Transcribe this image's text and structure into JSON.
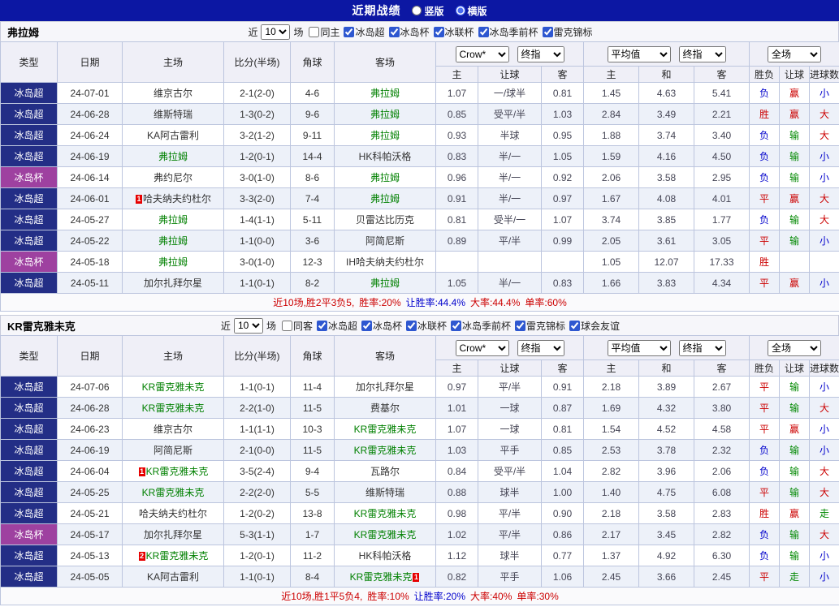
{
  "colors": {
    "bar-bg": "#0c17a3",
    "league-bg": "#232e86",
    "cup-bg": "#9e41a0",
    "header-bg": "#efeff7",
    "filter-bg": "#f6f6fa",
    "alt-row": "#edf1f9",
    "summary-bg": "#fafafc",
    "border": "#bcc5de",
    "focus-green": "#008000",
    "red": "#cc0000",
    "blue": "#0000cc",
    "green": "#008800",
    "badge-red": "#e60000"
  },
  "topbar": {
    "title": "近期战绩",
    "options": [
      {
        "label": "竖版",
        "checked": false
      },
      {
        "label": "横版",
        "checked": true
      }
    ]
  },
  "headers": {
    "main": [
      "类型",
      "日期",
      "主场",
      "比分(半场)",
      "角球",
      "客场"
    ],
    "sub": [
      "主",
      "让球",
      "客",
      "主",
      "和",
      "客",
      "胜负",
      "让球",
      "进球数"
    ],
    "selects": {
      "company": "Crow*",
      "asian_time": "终指",
      "euro_type": "平均值",
      "euro_time": "终指",
      "scope": "全场"
    }
  },
  "teams": [
    {
      "name": "弗拉姆",
      "filter": {
        "near": "近",
        "count": "10",
        "games": "场",
        "same": {
          "label": "同主",
          "checked": false
        },
        "comps": [
          {
            "label": "冰岛超",
            "checked": true
          },
          {
            "label": "冰岛杯",
            "checked": true
          },
          {
            "label": "冰联杯",
            "checked": true
          },
          {
            "label": "冰岛季前杯",
            "checked": true
          },
          {
            "label": "雷克锦标",
            "checked": true
          }
        ]
      },
      "rows": [
        {
          "comp": "冰岛超",
          "cup": false,
          "date": "24-07-01",
          "home": {
            "name": "维京古尔",
            "focus": false
          },
          "score": "2-1(2-0)",
          "corner": "4-6",
          "away": {
            "name": "弗拉姆",
            "focus": true
          },
          "asian": [
            "1.07",
            "一/球半",
            "0.81"
          ],
          "euro": [
            "1.45",
            "4.63",
            "5.41"
          ],
          "res": [
            {
              "t": "负",
              "c": "blue"
            },
            {
              "t": "赢",
              "c": "red"
            },
            {
              "t": "小",
              "c": "blue"
            }
          ]
        },
        {
          "comp": "冰岛超",
          "cup": false,
          "date": "24-06-28",
          "home": {
            "name": "维斯特瑞",
            "focus": false
          },
          "score": "1-3(0-2)",
          "corner": "9-6",
          "away": {
            "name": "弗拉姆",
            "focus": true
          },
          "asian": [
            "0.85",
            "受平/半",
            "1.03"
          ],
          "euro": [
            "2.84",
            "3.49",
            "2.21"
          ],
          "res": [
            {
              "t": "胜",
              "c": "red"
            },
            {
              "t": "赢",
              "c": "red"
            },
            {
              "t": "大",
              "c": "red"
            }
          ]
        },
        {
          "comp": "冰岛超",
          "cup": false,
          "date": "24-06-24",
          "home": {
            "name": "KA阿古雷利",
            "focus": false
          },
          "score": "3-2(1-2)",
          "corner": "9-11",
          "away": {
            "name": "弗拉姆",
            "focus": true
          },
          "asian": [
            "0.93",
            "半球",
            "0.95"
          ],
          "euro": [
            "1.88",
            "3.74",
            "3.40"
          ],
          "res": [
            {
              "t": "负",
              "c": "blue"
            },
            {
              "t": "输",
              "c": "green"
            },
            {
              "t": "大",
              "c": "red"
            }
          ]
        },
        {
          "comp": "冰岛超",
          "cup": false,
          "date": "24-06-19",
          "home": {
            "name": "弗拉姆",
            "focus": true
          },
          "score": "1-2(0-1)",
          "corner": "14-4",
          "away": {
            "name": "HK科帕沃格",
            "focus": false
          },
          "asian": [
            "0.83",
            "半/一",
            "1.05"
          ],
          "euro": [
            "1.59",
            "4.16",
            "4.50"
          ],
          "res": [
            {
              "t": "负",
              "c": "blue"
            },
            {
              "t": "输",
              "c": "green"
            },
            {
              "t": "小",
              "c": "blue"
            }
          ]
        },
        {
          "comp": "冰岛杯",
          "cup": true,
          "date": "24-06-14",
          "home": {
            "name": "弗约尼尔",
            "focus": false
          },
          "score": "3-0(1-0)",
          "corner": "8-6",
          "away": {
            "name": "弗拉姆",
            "focus": true
          },
          "asian": [
            "0.96",
            "半/一",
            "0.92"
          ],
          "euro": [
            "2.06",
            "3.58",
            "2.95"
          ],
          "res": [
            {
              "t": "负",
              "c": "blue"
            },
            {
              "t": "输",
              "c": "green"
            },
            {
              "t": "小",
              "c": "blue"
            }
          ]
        },
        {
          "comp": "冰岛超",
          "cup": false,
          "date": "24-06-01",
          "home": {
            "name": "哈夫纳夫约杜尔",
            "focus": false,
            "badge": "1",
            "badge_pos": "before"
          },
          "score": "3-3(2-0)",
          "corner": "7-4",
          "away": {
            "name": "弗拉姆",
            "focus": true
          },
          "asian": [
            "0.91",
            "半/一",
            "0.97"
          ],
          "euro": [
            "1.67",
            "4.08",
            "4.01"
          ],
          "res": [
            {
              "t": "平",
              "c": "red"
            },
            {
              "t": "赢",
              "c": "red"
            },
            {
              "t": "大",
              "c": "red"
            }
          ]
        },
        {
          "comp": "冰岛超",
          "cup": false,
          "date": "24-05-27",
          "home": {
            "name": "弗拉姆",
            "focus": true
          },
          "score": "1-4(1-1)",
          "corner": "5-11",
          "away": {
            "name": "贝雷达比历克",
            "focus": false
          },
          "asian": [
            "0.81",
            "受半/一",
            "1.07"
          ],
          "euro": [
            "3.74",
            "3.85",
            "1.77"
          ],
          "res": [
            {
              "t": "负",
              "c": "blue"
            },
            {
              "t": "输",
              "c": "green"
            },
            {
              "t": "大",
              "c": "red"
            }
          ]
        },
        {
          "comp": "冰岛超",
          "cup": false,
          "date": "24-05-22",
          "home": {
            "name": "弗拉姆",
            "focus": true
          },
          "score": "1-1(0-0)",
          "corner": "3-6",
          "away": {
            "name": "阿简尼斯",
            "focus": false
          },
          "asian": [
            "0.89",
            "平/半",
            "0.99"
          ],
          "euro": [
            "2.05",
            "3.61",
            "3.05"
          ],
          "res": [
            {
              "t": "平",
              "c": "red"
            },
            {
              "t": "输",
              "c": "green"
            },
            {
              "t": "小",
              "c": "blue"
            }
          ]
        },
        {
          "comp": "冰岛杯",
          "cup": true,
          "date": "24-05-18",
          "home": {
            "name": "弗拉姆",
            "focus": true
          },
          "score": "3-0(1-0)",
          "corner": "12-3",
          "away": {
            "name": "IH哈夫纳夫约杜尔",
            "focus": false
          },
          "asian": [
            "",
            "",
            ""
          ],
          "euro": [
            "1.05",
            "12.07",
            "17.33"
          ],
          "res": [
            {
              "t": "胜",
              "c": "red"
            },
            {
              "t": "",
              "c": ""
            },
            {
              "t": "",
              "c": ""
            }
          ]
        },
        {
          "comp": "冰岛超",
          "cup": false,
          "date": "24-05-11",
          "home": {
            "name": "加尔扎拜尔星",
            "focus": false
          },
          "score": "1-1(0-1)",
          "corner": "8-2",
          "away": {
            "name": "弗拉姆",
            "focus": true
          },
          "asian": [
            "1.05",
            "半/一",
            "0.83"
          ],
          "euro": [
            "1.66",
            "3.83",
            "4.34"
          ],
          "res": [
            {
              "t": "平",
              "c": "red"
            },
            {
              "t": "赢",
              "c": "red"
            },
            {
              "t": "小",
              "c": "blue"
            }
          ]
        }
      ],
      "summary": [
        {
          "t": "近10场,胜2平3负5,",
          "c": "red"
        },
        {
          "t": "胜率:20%",
          "c": "red"
        },
        {
          "t": "让胜率:44.4%",
          "c": "blue"
        },
        {
          "t": "大率:44.4%",
          "c": "red"
        },
        {
          "t": "单率:60%",
          "c": "red"
        }
      ]
    },
    {
      "name": "KR雷克雅未克",
      "filter": {
        "near": "近",
        "count": "10",
        "games": "场",
        "same": {
          "label": "同客",
          "checked": false
        },
        "comps": [
          {
            "label": "冰岛超",
            "checked": true
          },
          {
            "label": "冰岛杯",
            "checked": true
          },
          {
            "label": "冰联杯",
            "checked": true
          },
          {
            "label": "冰岛季前杯",
            "checked": true
          },
          {
            "label": "雷克锦标",
            "checked": true
          },
          {
            "label": "球会友谊",
            "checked": true
          }
        ]
      },
      "rows": [
        {
          "comp": "冰岛超",
          "cup": false,
          "date": "24-07-06",
          "home": {
            "name": "KR雷克雅未克",
            "focus": true
          },
          "score": "1-1(0-1)",
          "corner": "11-4",
          "away": {
            "name": "加尔扎拜尔星",
            "focus": false
          },
          "asian": [
            "0.97",
            "平/半",
            "0.91"
          ],
          "euro": [
            "2.18",
            "3.89",
            "2.67"
          ],
          "res": [
            {
              "t": "平",
              "c": "red"
            },
            {
              "t": "输",
              "c": "green"
            },
            {
              "t": "小",
              "c": "blue"
            }
          ]
        },
        {
          "comp": "冰岛超",
          "cup": false,
          "date": "24-06-28",
          "home": {
            "name": "KR雷克雅未克",
            "focus": true
          },
          "score": "2-2(1-0)",
          "corner": "11-5",
          "away": {
            "name": "费基尔",
            "focus": false
          },
          "asian": [
            "1.01",
            "一球",
            "0.87"
          ],
          "euro": [
            "1.69",
            "4.32",
            "3.80"
          ],
          "res": [
            {
              "t": "平",
              "c": "red"
            },
            {
              "t": "输",
              "c": "green"
            },
            {
              "t": "大",
              "c": "red"
            }
          ]
        },
        {
          "comp": "冰岛超",
          "cup": false,
          "date": "24-06-23",
          "home": {
            "name": "维京古尔",
            "focus": false
          },
          "score": "1-1(1-1)",
          "corner": "10-3",
          "away": {
            "name": "KR雷克雅未克",
            "focus": true
          },
          "asian": [
            "1.07",
            "一球",
            "0.81"
          ],
          "euro": [
            "1.54",
            "4.52",
            "4.58"
          ],
          "res": [
            {
              "t": "平",
              "c": "red"
            },
            {
              "t": "赢",
              "c": "red"
            },
            {
              "t": "小",
              "c": "blue"
            }
          ]
        },
        {
          "comp": "冰岛超",
          "cup": false,
          "date": "24-06-19",
          "home": {
            "name": "阿简尼斯",
            "focus": false
          },
          "score": "2-1(0-0)",
          "corner": "11-5",
          "away": {
            "name": "KR雷克雅未克",
            "focus": true
          },
          "asian": [
            "1.03",
            "平手",
            "0.85"
          ],
          "euro": [
            "2.53",
            "3.78",
            "2.32"
          ],
          "res": [
            {
              "t": "负",
              "c": "blue"
            },
            {
              "t": "输",
              "c": "green"
            },
            {
              "t": "小",
              "c": "blue"
            }
          ]
        },
        {
          "comp": "冰岛超",
          "cup": false,
          "date": "24-06-04",
          "home": {
            "name": "KR雷克雅未克",
            "focus": true,
            "badge": "1",
            "badge_pos": "before"
          },
          "score": "3-5(2-4)",
          "corner": "9-4",
          "away": {
            "name": "瓦路尔",
            "focus": false
          },
          "asian": [
            "0.84",
            "受平/半",
            "1.04"
          ],
          "euro": [
            "2.82",
            "3.96",
            "2.06"
          ],
          "res": [
            {
              "t": "负",
              "c": "blue"
            },
            {
              "t": "输",
              "c": "green"
            },
            {
              "t": "大",
              "c": "red"
            }
          ]
        },
        {
          "comp": "冰岛超",
          "cup": false,
          "date": "24-05-25",
          "home": {
            "name": "KR雷克雅未克",
            "focus": true
          },
          "score": "2-2(2-0)",
          "corner": "5-5",
          "away": {
            "name": "维斯特瑞",
            "focus": false
          },
          "asian": [
            "0.88",
            "球半",
            "1.00"
          ],
          "euro": [
            "1.40",
            "4.75",
            "6.08"
          ],
          "res": [
            {
              "t": "平",
              "c": "red"
            },
            {
              "t": "输",
              "c": "green"
            },
            {
              "t": "大",
              "c": "red"
            }
          ]
        },
        {
          "comp": "冰岛超",
          "cup": false,
          "date": "24-05-21",
          "home": {
            "name": "哈夫纳夫约杜尔",
            "focus": false
          },
          "score": "1-2(0-2)",
          "corner": "13-8",
          "away": {
            "name": "KR雷克雅未克",
            "focus": true
          },
          "asian": [
            "0.98",
            "平/半",
            "0.90"
          ],
          "euro": [
            "2.18",
            "3.58",
            "2.83"
          ],
          "res": [
            {
              "t": "胜",
              "c": "red"
            },
            {
              "t": "赢",
              "c": "red"
            },
            {
              "t": "走",
              "c": "green"
            }
          ]
        },
        {
          "comp": "冰岛杯",
          "cup": true,
          "date": "24-05-17",
          "home": {
            "name": "加尔扎拜尔星",
            "focus": false
          },
          "score": "5-3(1-1)",
          "corner": "1-7",
          "away": {
            "name": "KR雷克雅未克",
            "focus": true
          },
          "asian": [
            "1.02",
            "平/半",
            "0.86"
          ],
          "euro": [
            "2.17",
            "3.45",
            "2.82"
          ],
          "res": [
            {
              "t": "负",
              "c": "blue"
            },
            {
              "t": "输",
              "c": "green"
            },
            {
              "t": "大",
              "c": "red"
            }
          ]
        },
        {
          "comp": "冰岛超",
          "cup": false,
          "date": "24-05-13",
          "home": {
            "name": "KR雷克雅未克",
            "focus": true,
            "badge": "2",
            "badge_pos": "before"
          },
          "score": "1-2(0-1)",
          "corner": "11-2",
          "away": {
            "name": "HK科帕沃格",
            "focus": false
          },
          "asian": [
            "1.12",
            "球半",
            "0.77"
          ],
          "euro": [
            "1.37",
            "4.92",
            "6.30"
          ],
          "res": [
            {
              "t": "负",
              "c": "blue"
            },
            {
              "t": "输",
              "c": "green"
            },
            {
              "t": "小",
              "c": "blue"
            }
          ]
        },
        {
          "comp": "冰岛超",
          "cup": false,
          "date": "24-05-05",
          "home": {
            "name": "KA阿古雷利",
            "focus": false
          },
          "score": "1-1(0-1)",
          "corner": "8-4",
          "away": {
            "name": "KR雷克雅未克",
            "focus": true,
            "badge": "1",
            "badge_pos": "after"
          },
          "asian": [
            "0.82",
            "平手",
            "1.06"
          ],
          "euro": [
            "2.45",
            "3.66",
            "2.45"
          ],
          "res": [
            {
              "t": "平",
              "c": "red"
            },
            {
              "t": "走",
              "c": "green"
            },
            {
              "t": "小",
              "c": "blue"
            }
          ]
        }
      ],
      "summary": [
        {
          "t": "近10场,胜1平5负4,",
          "c": "red"
        },
        {
          "t": "胜率:10%",
          "c": "red"
        },
        {
          "t": "让胜率:20%",
          "c": "blue"
        },
        {
          "t": "大率:40%",
          "c": "red"
        },
        {
          "t": "单率:30%",
          "c": "red"
        }
      ]
    }
  ]
}
